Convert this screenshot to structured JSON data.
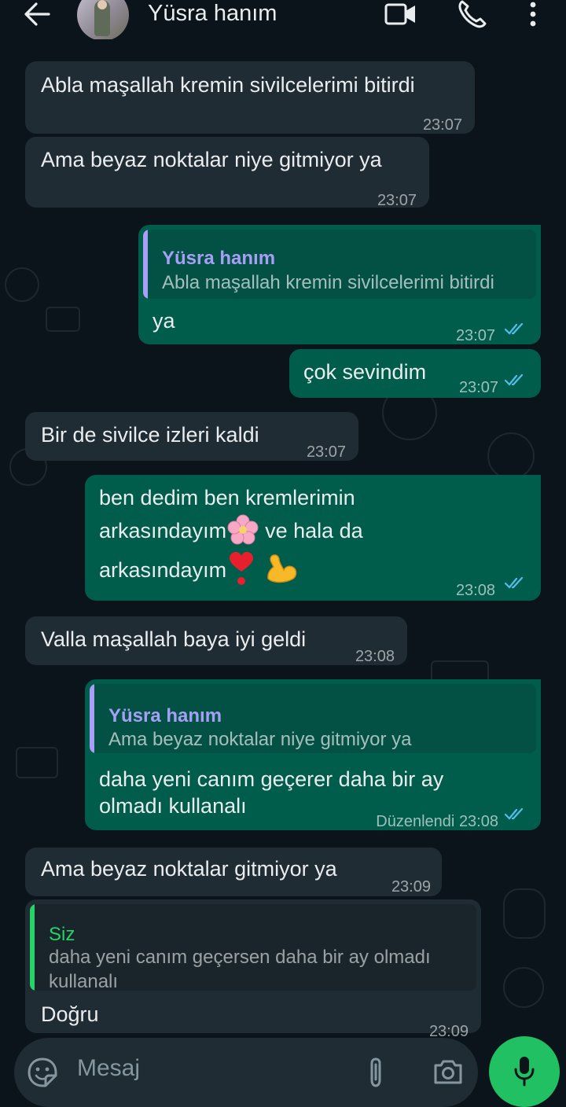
{
  "header": {
    "contact_name": "Yüsra hanım",
    "icons": [
      "back-arrow-icon",
      "video-call-icon",
      "phone-icon",
      "more-options-icon"
    ]
  },
  "messages": [
    {
      "dir": "in",
      "text": "Abla maşallah kremin sivilcelerimi bitirdi",
      "time": "23:07"
    },
    {
      "dir": "in",
      "text": "Ama beyaz noktalar niye gitmiyor ya",
      "time": "23:07"
    },
    {
      "dir": "out",
      "quote_name": "Yüsra hanım",
      "quote_text": "Abla maşallah kremin sivilcelerimi bitirdi",
      "text": "ya",
      "time": "23:07",
      "status": "read"
    },
    {
      "dir": "out",
      "text": "çok sevindim",
      "time": "23:07",
      "status": "read"
    },
    {
      "dir": "in",
      "text": "Bir de sivilce izleri kaldi",
      "time": "23:07"
    },
    {
      "dir": "out",
      "lines": [
        "ben dedim ben kremlerimin",
        "arkasındayım",
        "ve hala da",
        "arkasındayım"
      ],
      "time": "23:08",
      "status": "read"
    },
    {
      "dir": "in",
      "text": "Valla maşallah baya iyi geldi",
      "time": "23:08"
    },
    {
      "dir": "out",
      "quote_name": "Yüsra hanım",
      "quote_text": "Ama beyaz noktalar niye gitmiyor ya",
      "lines": [
        "daha yeni canım geçerer daha bir ay",
        "olmadı kullanalı"
      ],
      "edited": "Düzenlendi",
      "time": "23:08",
      "status": "read"
    },
    {
      "dir": "in",
      "text": "Ama beyaz noktalar gitmiyor ya",
      "time": "23:09"
    },
    {
      "dir": "in",
      "quote_name": "Siz",
      "quote_lines": [
        "daha yeni canım geçersen daha bir ay olmadı",
        "kullanalı"
      ],
      "text": "Doğru",
      "time": "23:09"
    }
  ],
  "composer": {
    "placeholder": "Mesaj",
    "icons": [
      "sticker-icon",
      "attach-icon",
      "camera-icon",
      "mic-icon"
    ]
  },
  "colors": {
    "background": "#0b141a",
    "incoming": "#202c33",
    "outgoing": "#005c4b",
    "accent": "#21c063",
    "read_ticks": "#53bdeb",
    "quote_name_out": "#a79ff5",
    "quote_bar_out": "#a79ff5",
    "quote_name_in": "#25d366"
  }
}
